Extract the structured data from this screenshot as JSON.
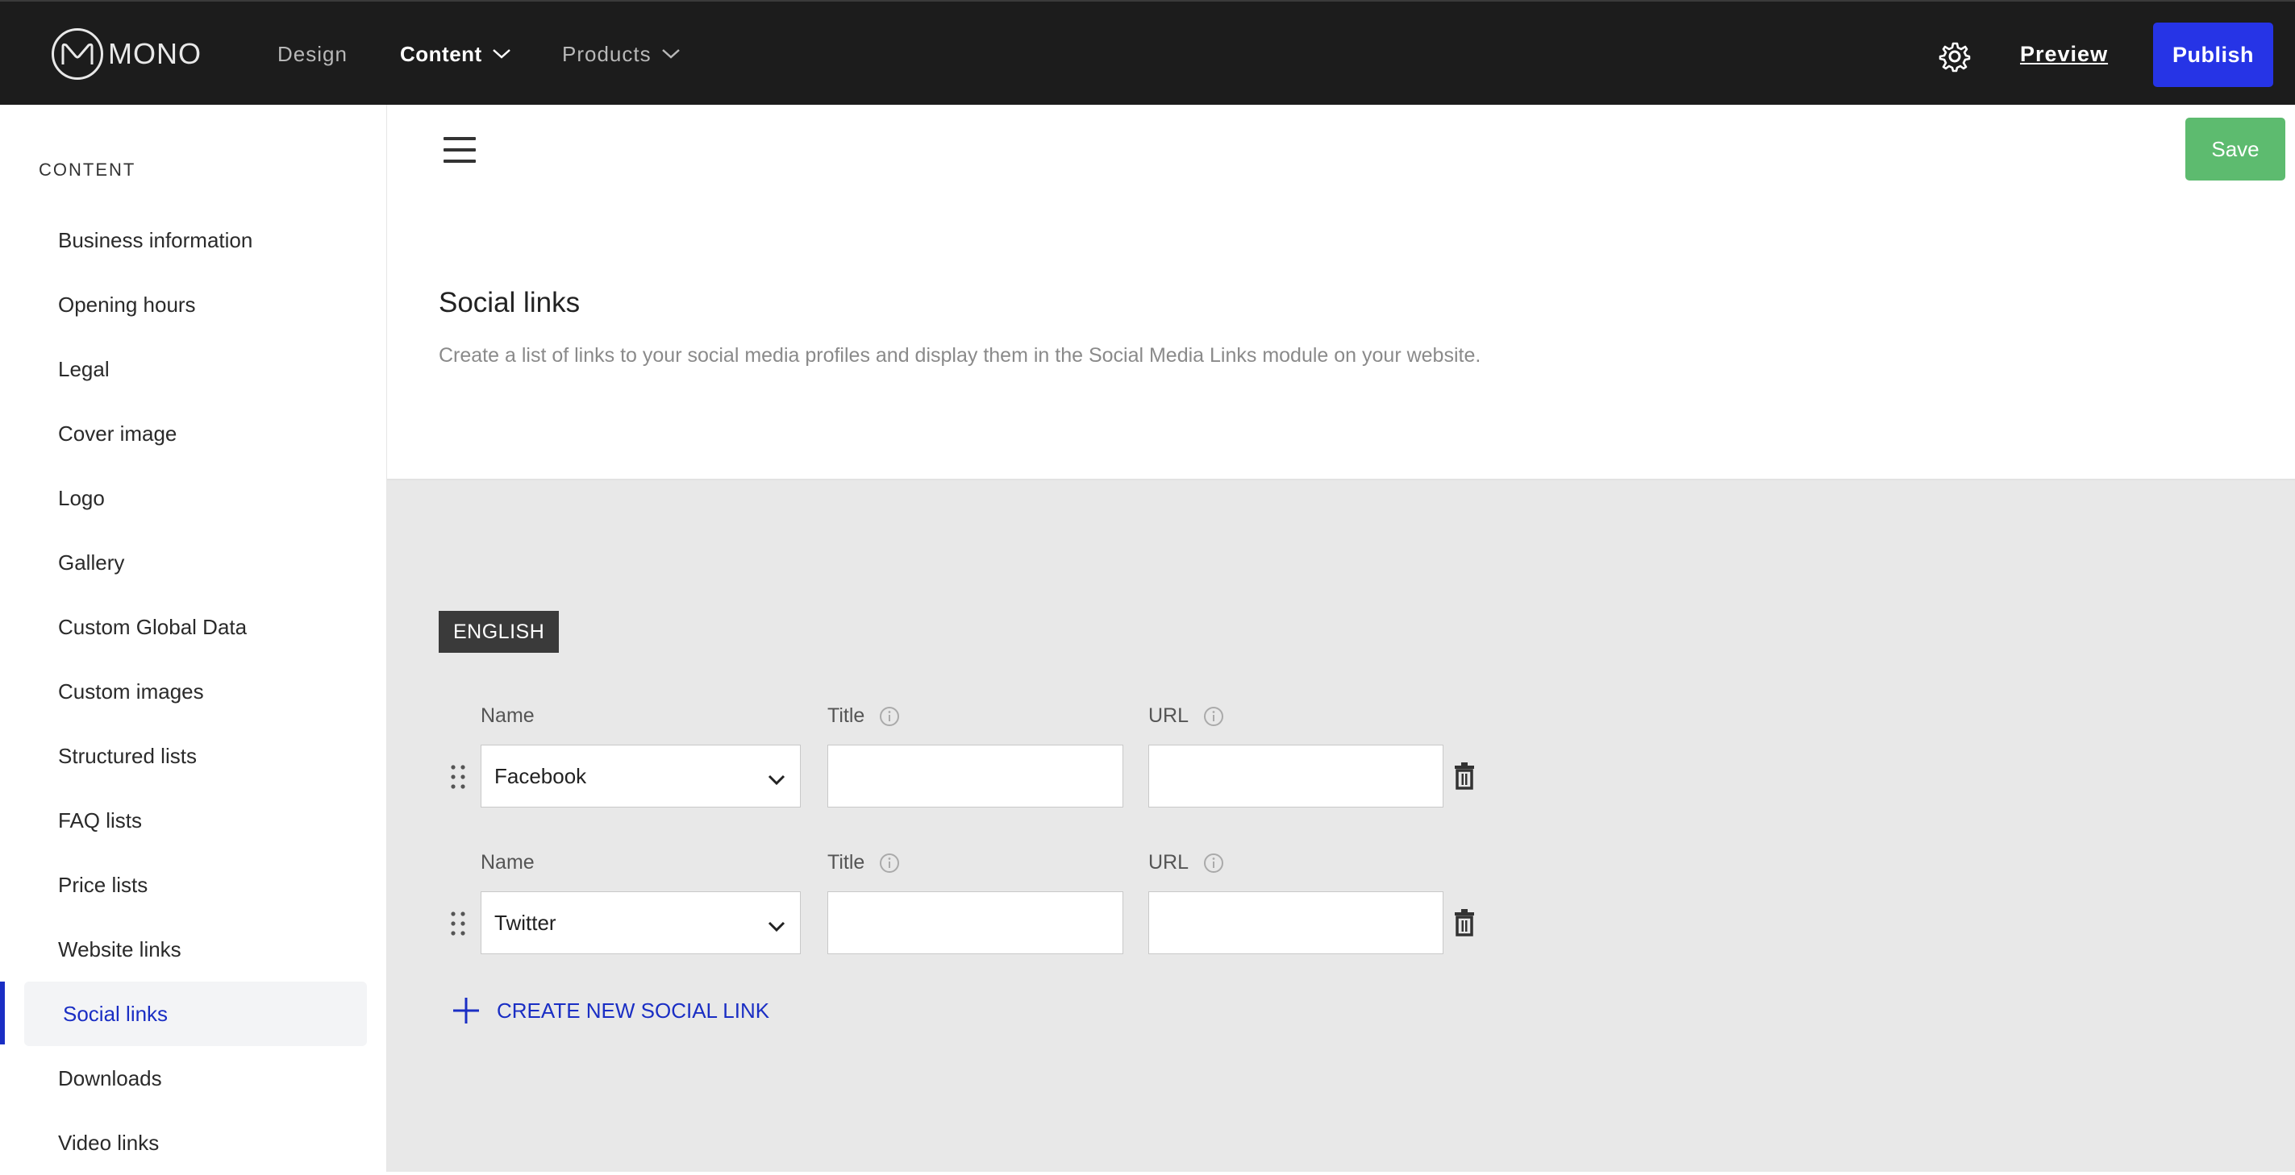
{
  "header": {
    "logo_text": "MONO",
    "nav": [
      {
        "label": "Design"
      },
      {
        "label": "Content"
      },
      {
        "label": "Products"
      }
    ],
    "preview_label": "Preview",
    "publish_label": "Publish",
    "icons": {
      "settings": "gear-icon",
      "dropdown": "chevron-down-icon"
    }
  },
  "sidebar": {
    "heading": "CONTENT",
    "items": [
      {
        "label": "Business information"
      },
      {
        "label": "Opening hours"
      },
      {
        "label": "Legal"
      },
      {
        "label": "Cover image"
      },
      {
        "label": "Logo"
      },
      {
        "label": "Gallery"
      },
      {
        "label": "Custom Global Data"
      },
      {
        "label": "Custom images"
      },
      {
        "label": "Structured lists"
      },
      {
        "label": "FAQ lists"
      },
      {
        "label": "Price lists"
      },
      {
        "label": "Website links"
      },
      {
        "label": "Social links",
        "active": true
      },
      {
        "label": "Downloads"
      },
      {
        "label": "Video links"
      }
    ]
  },
  "main": {
    "save_label": "Save",
    "title": "Social links",
    "description": "Create a list of links to your social media profiles and display them in the Social Media Links module on your website.",
    "language": "ENGLISH",
    "links": [
      {
        "name_label": "Name",
        "name_value": "Facebook",
        "title_label": "Title",
        "title_value": "",
        "url_label": "URL",
        "url_value": ""
      },
      {
        "name_label": "Name",
        "name_value": "Twitter",
        "title_label": "Title",
        "title_value": "",
        "url_label": "URL",
        "url_value": ""
      }
    ],
    "create_label": "CREATE NEW SOCIAL LINK"
  },
  "colors": {
    "topbar": "#1c1c1c",
    "publish": "#2634e6",
    "save": "#5dbb6f",
    "accent": "#1a2ec4",
    "content_bg": "#e8e8e8"
  }
}
